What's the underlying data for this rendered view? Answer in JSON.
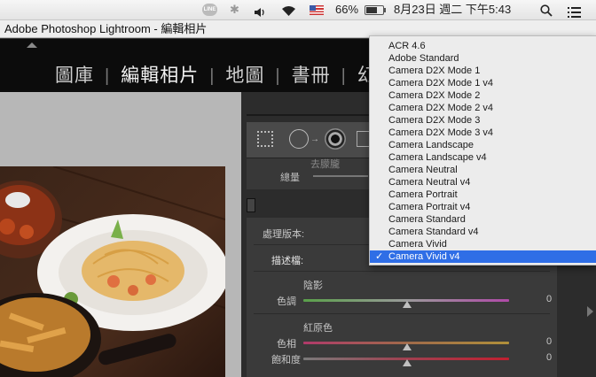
{
  "menubar": {
    "line_icon_text": "LINE",
    "battery_percent": "66%",
    "clock": "8月23日 週二 下午5:43"
  },
  "window": {
    "title": "Adobe Photoshop Lightroom - 編輯相片"
  },
  "modules": {
    "items": [
      "圖庫",
      "編輯相片",
      "地圖",
      "書冊",
      "幻"
    ],
    "active": "編輯相片"
  },
  "panel": {
    "detail_cutoff": "去朦朧",
    "detail_amount_label": "總量",
    "process_label": "處理版本:",
    "profile_label": "描述檔:",
    "shadows": {
      "heading": "陰影",
      "tint_label": "色調",
      "tint_value": "0"
    },
    "red_primary": {
      "heading": "紅原色",
      "hue_label": "色相",
      "hue_value": "0",
      "saturation_label": "飽和度",
      "saturation_value": "0"
    }
  },
  "profile_menu": {
    "items": [
      "ACR 4.6",
      "Adobe Standard",
      "Camera D2X Mode 1",
      "Camera D2X Mode 1 v4",
      "Camera D2X Mode 2",
      "Camera D2X Mode 2 v4",
      "Camera D2X Mode 3",
      "Camera D2X Mode 3 v4",
      "Camera Landscape",
      "Camera Landscape v4",
      "Camera Neutral",
      "Camera Neutral v4",
      "Camera Portrait",
      "Camera Portrait v4",
      "Camera Standard",
      "Camera Standard v4",
      "Camera Vivid",
      "Camera Vivid v4"
    ],
    "selected": "Camera Vivid v4",
    "check_mark": "✓",
    "selection_color": "#2f6ee6"
  },
  "colors": {
    "background_panel": "#3a3a3a",
    "module_bar": "#0c0c0c"
  }
}
